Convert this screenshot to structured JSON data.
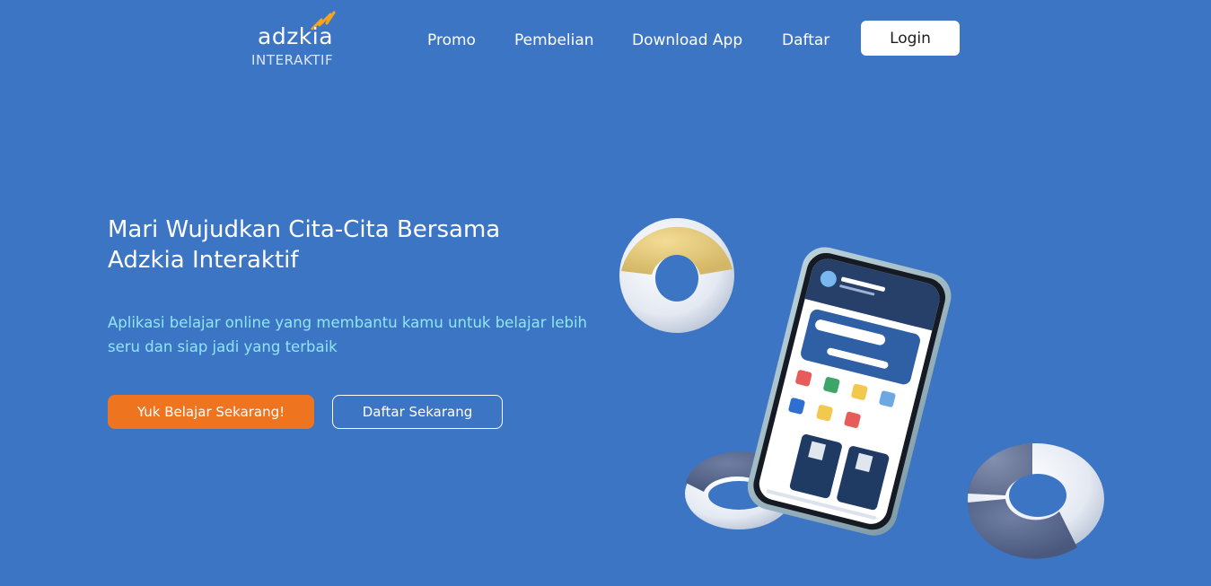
{
  "header": {
    "logo": {
      "wordmark": "adzkia",
      "subtitle": "INTERAKTIF"
    },
    "nav": [
      {
        "label": "Promo"
      },
      {
        "label": "Pembelian"
      },
      {
        "label": "Download App"
      },
      {
        "label": "Daftar"
      }
    ],
    "login_label": "Login"
  },
  "hero": {
    "title_lines": [
      "Mari Wujudkan Cita-Cita Bersama",
      "Adzkia Interaktif"
    ],
    "subtitle_lines": [
      "Aplikasi belajar online yang membantu kamu untuk belajar lebih",
      "seru dan siap jadi yang terbaik"
    ],
    "primary_button": "Yuk Belajar Sekarang!",
    "secondary_button": "Daftar Sekarang"
  },
  "colors": {
    "background": "#3d75c5",
    "primary_button": "#ef7420",
    "subtitle": "#8fe6f3",
    "login_bg": "#ffffff"
  },
  "icons": [
    "logo-bird-icon",
    "donut-decoration",
    "phone-mockup"
  ]
}
